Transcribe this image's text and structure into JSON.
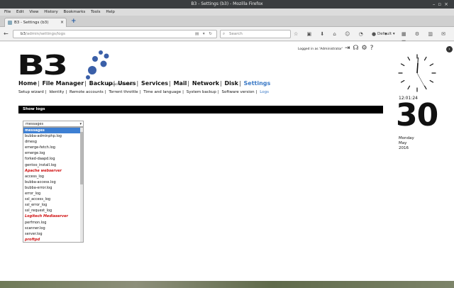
{
  "window": {
    "title": "B3 - Settings (b3) - Mozilla Firefox"
  },
  "menubar": [
    "File",
    "Edit",
    "View",
    "History",
    "Bookmarks",
    "Tools",
    "Help"
  ],
  "tab": {
    "label": "B3 - Settings (b3)",
    "close": "×"
  },
  "newtab": "+",
  "navbar": {
    "url_host": "b3",
    "url_path": "/admin/settings/logs",
    "search_placeholder": "Search",
    "default_label": "Default"
  },
  "header": {
    "logo_text": "B3",
    "logo_byline": "by Excito Sweden",
    "logged_in": "Logged in as 'Administrator'"
  },
  "main_nav": [
    {
      "label": "Home"
    },
    {
      "label": "File Manager"
    },
    {
      "label": "Backup"
    },
    {
      "label": "Users"
    },
    {
      "label": "Services"
    },
    {
      "label": "Mail"
    },
    {
      "label": "Network"
    },
    {
      "label": "Disk"
    },
    {
      "label": "Settings",
      "active": true
    }
  ],
  "sub_nav": [
    {
      "label": "Setup wizard"
    },
    {
      "label": "Identity"
    },
    {
      "label": "Remote accounts"
    },
    {
      "label": "Torrent throttle"
    },
    {
      "label": "Time and language"
    },
    {
      "label": "System backup"
    },
    {
      "label": "Software version"
    },
    {
      "label": "Logs",
      "active": true
    }
  ],
  "section_title": "Show logs",
  "log_select": {
    "value": "messages",
    "options": [
      {
        "label": "messages",
        "type": "selected"
      },
      {
        "label": "bubba-adminphp.log",
        "type": "item"
      },
      {
        "label": "dmesg",
        "type": "item"
      },
      {
        "label": "emerge-fetch.log",
        "type": "item"
      },
      {
        "label": "emerge.log",
        "type": "item"
      },
      {
        "label": "forked-daapd.log",
        "type": "item"
      },
      {
        "label": "gentoo_install.log",
        "type": "item"
      },
      {
        "label": "Apache webserver",
        "type": "group"
      },
      {
        "label": "access_log",
        "type": "item"
      },
      {
        "label": "bubba-access.log",
        "type": "item"
      },
      {
        "label": "bubba-error.log",
        "type": "item"
      },
      {
        "label": "error_log",
        "type": "item"
      },
      {
        "label": "ssl_access_log",
        "type": "item"
      },
      {
        "label": "ssl_error_log",
        "type": "item"
      },
      {
        "label": "ssl_request_log",
        "type": "item"
      },
      {
        "label": "Logitech Mediaserver",
        "type": "group"
      },
      {
        "label": "perfmon.log",
        "type": "item"
      },
      {
        "label": "scanner.log",
        "type": "item"
      },
      {
        "label": "server.log",
        "type": "item"
      },
      {
        "label": "proftpd",
        "type": "group"
      }
    ]
  },
  "clock": {
    "time": "12:01:24",
    "day": "30",
    "weekday": "Monday",
    "month": "May",
    "year": "2016"
  },
  "colors": {
    "accent": "#3a79c6",
    "group": "#d01010",
    "selected": "#3d7fd3"
  }
}
